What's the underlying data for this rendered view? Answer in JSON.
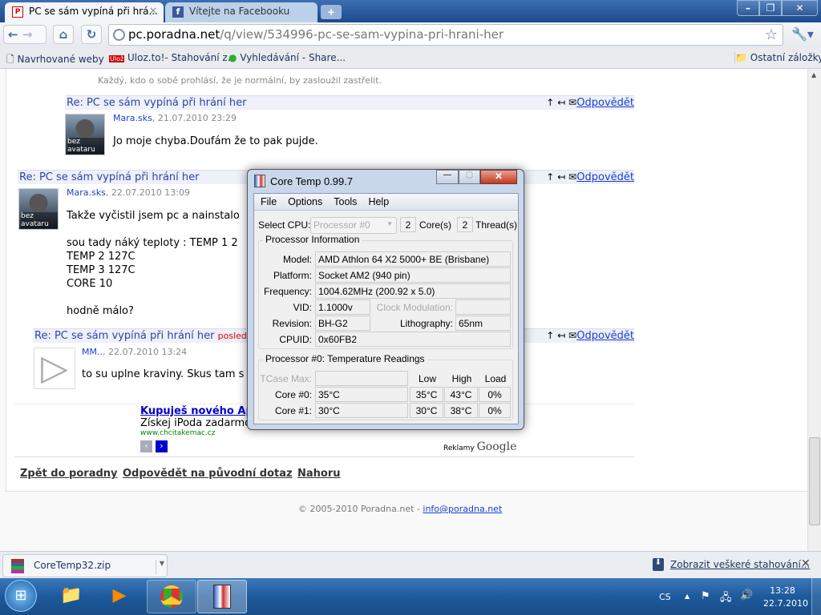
{
  "browser": {
    "tabs": [
      {
        "title": "PC se sám vypíná při hrá...",
        "active": true
      },
      {
        "title": "Vítejte na Facebooku",
        "active": false
      }
    ],
    "url_host": "pc.poradna.net",
    "url_path": "/q/view/534996-pc-se-sam-vypina-pri-hrani-her",
    "bookmarks": [
      "Navrhované weby",
      "Uloz.to!- Stahování z...",
      "Vyhledávání - Share..."
    ],
    "other_bookmarks": "Ostatní záložky"
  },
  "page": {
    "quote": "Každý, kdo o sobě prohlásí, že je normální, by zasloužil zastřelit.",
    "reply_label": "Odpovědět",
    "avatar_label": "bez avataru",
    "posts": [
      {
        "title": "Re: PC se sám vypíná při hrání her",
        "author": "Mara.sks",
        "date": ", 21.07.2010 23:29",
        "text": "Jo moje chyba.Doufám že to pak pujde."
      },
      {
        "title": "Re: PC se sám vypíná při hrání her",
        "author": "Mara.sks",
        "date": ", 22.07.2010 13:09",
        "text": "Takže vyčistil jsem pc a nainstalo\n\nsou tady náký teploty : TEMP 1 2\nTEMP 2 127C\nTEMP 3 127C\nCORE 10\n\nhodně málo?"
      },
      {
        "title": "Re: PC se sám vypíná při hrání her",
        "badge": "poslední r",
        "author": "MM..",
        "date": ", 22.07.2010 13:24",
        "text": "to su uplne kraviny. Skus tam s"
      }
    ],
    "ad": {
      "title": "Kupuješ nového App",
      "text": "Získej iPoda zadarmo",
      "url": "www.chcitakemac.cz",
      "by": "Reklamy",
      "google": "Google"
    },
    "links": [
      "Zpět do poradny",
      "Odpovědět na původní dotaz",
      "Nahoru"
    ],
    "footer": "© 2005-2010 Poradna.net - ",
    "footer_email": "info@poradna.net"
  },
  "download": {
    "file": "CoreTemp32.zip",
    "show_all": "Zobrazit veškeré stahování..."
  },
  "taskbar": {
    "lang": "CS",
    "time": "13:28",
    "date": "22.7.2010"
  },
  "coretemp": {
    "title": "Core Temp 0.99.7",
    "menu": [
      "File",
      "Options",
      "Tools",
      "Help"
    ],
    "select_cpu_label": "Select CPU:",
    "cpu": "Processor #0",
    "cores": "2",
    "cores_label": "Core(s)",
    "threads": "2",
    "threads_label": "Thread(s)",
    "info_title": "Processor Information",
    "model_label": "Model:",
    "model": "AMD Athlon 64 X2 5000+ BE (Brisbane)",
    "platform_label": "Platform:",
    "platform": "Socket AM2 (940 pin)",
    "freq_label": "Frequency:",
    "freq": "1004.62MHz (200.92 x 5.0)",
    "vid_label": "VID:",
    "vid": "1.1000v",
    "clockmod_label": "Clock Modulation:",
    "rev_label": "Revision:",
    "rev": "BH-G2",
    "litho_label": "Lithography:",
    "litho": "65nm",
    "cpuid_label": "CPUID:",
    "cpuid": "0x60FB2",
    "temp_title": "Processor #0: Temperature Readings",
    "tcase_label": "TCase Max:",
    "low": "Low",
    "high": "High",
    "load": "Load",
    "cores_rows": [
      {
        "label": "Core #0:",
        "temp": "35°C",
        "low": "35°C",
        "high": "43°C",
        "load": "0%"
      },
      {
        "label": "Core #1:",
        "temp": "30°C",
        "low": "30°C",
        "high": "38°C",
        "load": "0%"
      }
    ]
  }
}
